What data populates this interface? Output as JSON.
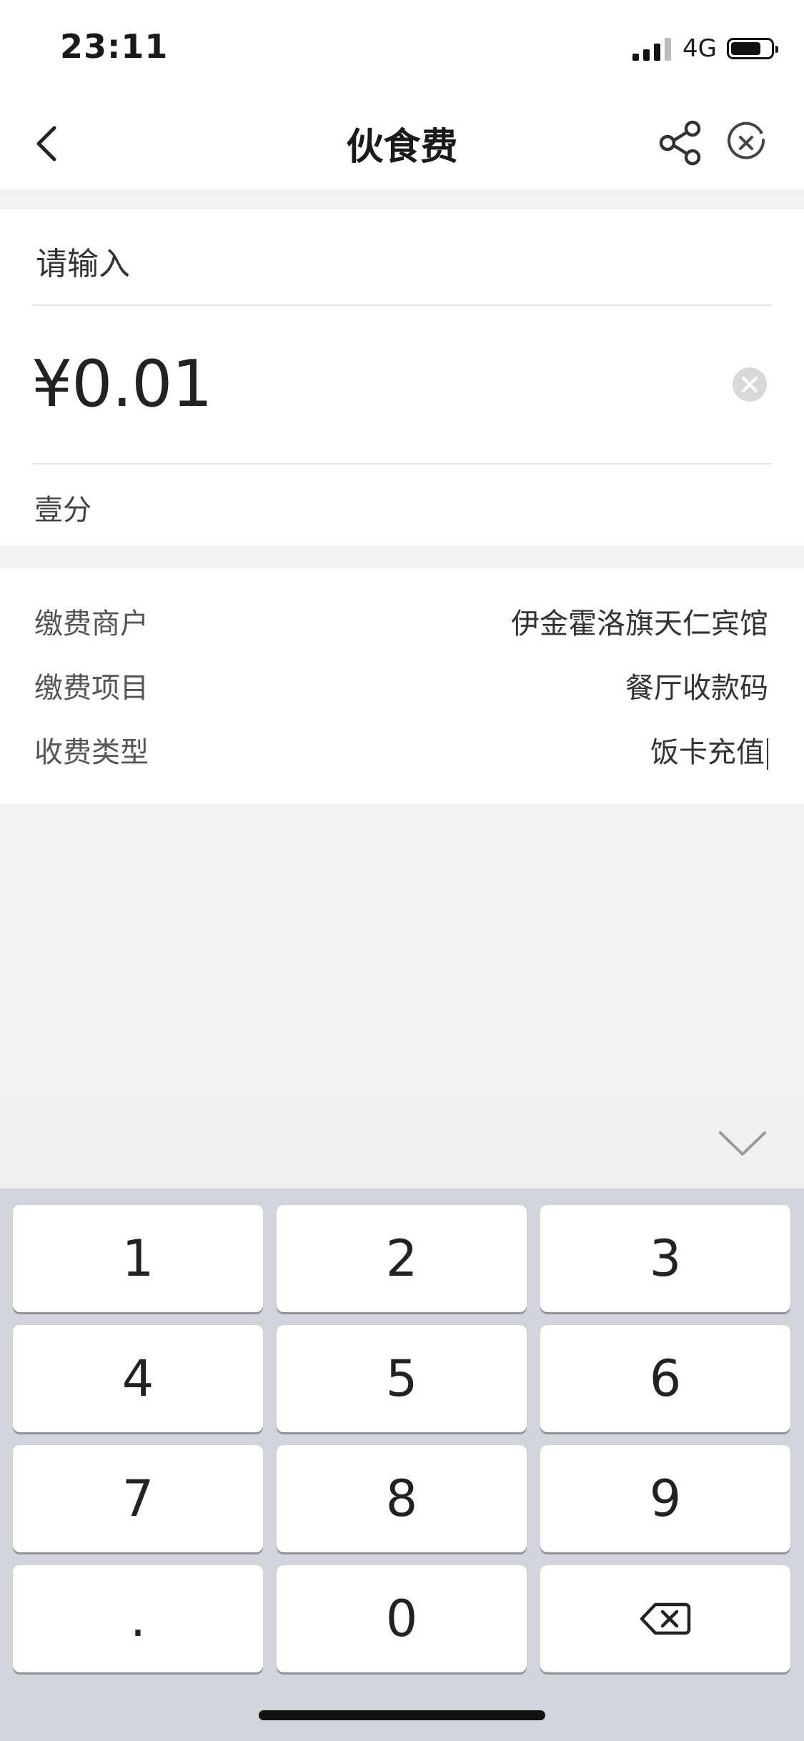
{
  "status_bar": {
    "time": "23:11",
    "network": "4G",
    "battery_level": 0.75
  },
  "nav": {
    "title": "伙食费",
    "back_icon": "chevron-left-icon",
    "share_icon": "share-icon",
    "close_icon": "close-circle-icon"
  },
  "amount_card": {
    "memo_placeholder": "请输入",
    "amount": "¥0.01",
    "amount_in_words": "壹分"
  },
  "details": [
    {
      "label": "缴费商户",
      "value": "伊金霍洛旗天仁宾馆"
    },
    {
      "label": "缴费项目",
      "value": "餐厅收款码"
    },
    {
      "label": "收费类型",
      "value": "饭卡充值"
    }
  ],
  "keyboard": {
    "dismiss_icon": "chevron-down-icon",
    "keys": [
      "1",
      "2",
      "3",
      "4",
      "5",
      "6",
      "7",
      "8",
      "9",
      ".",
      "0"
    ],
    "backspace_icon": "backspace-icon"
  }
}
